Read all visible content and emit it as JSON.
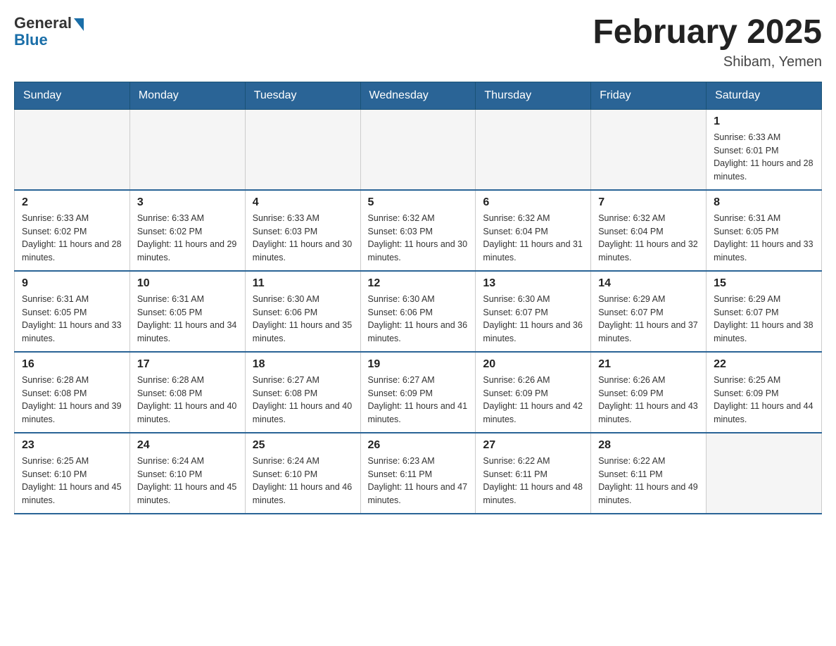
{
  "header": {
    "logo_general": "General",
    "logo_blue": "Blue",
    "month_title": "February 2025",
    "location": "Shibam, Yemen"
  },
  "weekdays": [
    "Sunday",
    "Monday",
    "Tuesday",
    "Wednesday",
    "Thursday",
    "Friday",
    "Saturday"
  ],
  "weeks": [
    [
      {
        "day": "",
        "info": ""
      },
      {
        "day": "",
        "info": ""
      },
      {
        "day": "",
        "info": ""
      },
      {
        "day": "",
        "info": ""
      },
      {
        "day": "",
        "info": ""
      },
      {
        "day": "",
        "info": ""
      },
      {
        "day": "1",
        "info": "Sunrise: 6:33 AM\nSunset: 6:01 PM\nDaylight: 11 hours and 28 minutes."
      }
    ],
    [
      {
        "day": "2",
        "info": "Sunrise: 6:33 AM\nSunset: 6:02 PM\nDaylight: 11 hours and 28 minutes."
      },
      {
        "day": "3",
        "info": "Sunrise: 6:33 AM\nSunset: 6:02 PM\nDaylight: 11 hours and 29 minutes."
      },
      {
        "day": "4",
        "info": "Sunrise: 6:33 AM\nSunset: 6:03 PM\nDaylight: 11 hours and 30 minutes."
      },
      {
        "day": "5",
        "info": "Sunrise: 6:32 AM\nSunset: 6:03 PM\nDaylight: 11 hours and 30 minutes."
      },
      {
        "day": "6",
        "info": "Sunrise: 6:32 AM\nSunset: 6:04 PM\nDaylight: 11 hours and 31 minutes."
      },
      {
        "day": "7",
        "info": "Sunrise: 6:32 AM\nSunset: 6:04 PM\nDaylight: 11 hours and 32 minutes."
      },
      {
        "day": "8",
        "info": "Sunrise: 6:31 AM\nSunset: 6:05 PM\nDaylight: 11 hours and 33 minutes."
      }
    ],
    [
      {
        "day": "9",
        "info": "Sunrise: 6:31 AM\nSunset: 6:05 PM\nDaylight: 11 hours and 33 minutes."
      },
      {
        "day": "10",
        "info": "Sunrise: 6:31 AM\nSunset: 6:05 PM\nDaylight: 11 hours and 34 minutes."
      },
      {
        "day": "11",
        "info": "Sunrise: 6:30 AM\nSunset: 6:06 PM\nDaylight: 11 hours and 35 minutes."
      },
      {
        "day": "12",
        "info": "Sunrise: 6:30 AM\nSunset: 6:06 PM\nDaylight: 11 hours and 36 minutes."
      },
      {
        "day": "13",
        "info": "Sunrise: 6:30 AM\nSunset: 6:07 PM\nDaylight: 11 hours and 36 minutes."
      },
      {
        "day": "14",
        "info": "Sunrise: 6:29 AM\nSunset: 6:07 PM\nDaylight: 11 hours and 37 minutes."
      },
      {
        "day": "15",
        "info": "Sunrise: 6:29 AM\nSunset: 6:07 PM\nDaylight: 11 hours and 38 minutes."
      }
    ],
    [
      {
        "day": "16",
        "info": "Sunrise: 6:28 AM\nSunset: 6:08 PM\nDaylight: 11 hours and 39 minutes."
      },
      {
        "day": "17",
        "info": "Sunrise: 6:28 AM\nSunset: 6:08 PM\nDaylight: 11 hours and 40 minutes."
      },
      {
        "day": "18",
        "info": "Sunrise: 6:27 AM\nSunset: 6:08 PM\nDaylight: 11 hours and 40 minutes."
      },
      {
        "day": "19",
        "info": "Sunrise: 6:27 AM\nSunset: 6:09 PM\nDaylight: 11 hours and 41 minutes."
      },
      {
        "day": "20",
        "info": "Sunrise: 6:26 AM\nSunset: 6:09 PM\nDaylight: 11 hours and 42 minutes."
      },
      {
        "day": "21",
        "info": "Sunrise: 6:26 AM\nSunset: 6:09 PM\nDaylight: 11 hours and 43 minutes."
      },
      {
        "day": "22",
        "info": "Sunrise: 6:25 AM\nSunset: 6:09 PM\nDaylight: 11 hours and 44 minutes."
      }
    ],
    [
      {
        "day": "23",
        "info": "Sunrise: 6:25 AM\nSunset: 6:10 PM\nDaylight: 11 hours and 45 minutes."
      },
      {
        "day": "24",
        "info": "Sunrise: 6:24 AM\nSunset: 6:10 PM\nDaylight: 11 hours and 45 minutes."
      },
      {
        "day": "25",
        "info": "Sunrise: 6:24 AM\nSunset: 6:10 PM\nDaylight: 11 hours and 46 minutes."
      },
      {
        "day": "26",
        "info": "Sunrise: 6:23 AM\nSunset: 6:11 PM\nDaylight: 11 hours and 47 minutes."
      },
      {
        "day": "27",
        "info": "Sunrise: 6:22 AM\nSunset: 6:11 PM\nDaylight: 11 hours and 48 minutes."
      },
      {
        "day": "28",
        "info": "Sunrise: 6:22 AM\nSunset: 6:11 PM\nDaylight: 11 hours and 49 minutes."
      },
      {
        "day": "",
        "info": ""
      }
    ]
  ]
}
